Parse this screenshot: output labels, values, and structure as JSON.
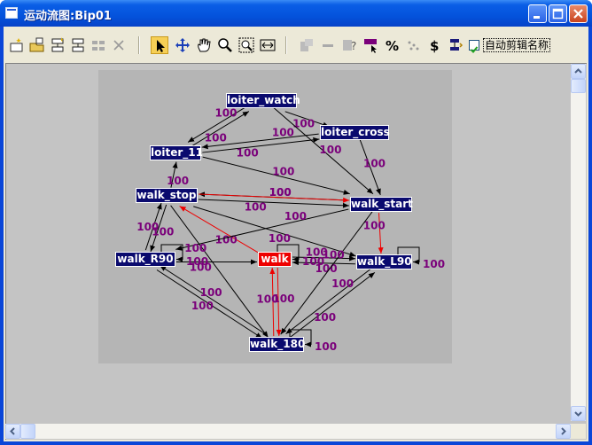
{
  "window": {
    "title": "运动流图:Bip01"
  },
  "toolbar": {
    "buttons": [
      "new-clip-icon",
      "open-clip-icon",
      "insert-transition-icon",
      "delete-transition-icon",
      "optimize-icon",
      "delete-icon",
      "select-icon",
      "move-icon",
      "pan-icon",
      "zoom-icon",
      "zoom-region-icon",
      "fit-width-icon",
      "script-icon",
      "line-icon",
      "help-icon",
      "flag-icon",
      "percent-icon",
      "random-icon",
      "dollar-icon",
      "marker-icon"
    ],
    "auto_clip_names_checked": true,
    "auto_clip_names_label": "自动剪辑名称"
  },
  "graph": {
    "nodes": [
      {
        "id": "loiter_watch",
        "label": "loiter_watch",
        "active": false
      },
      {
        "id": "loiter_cross",
        "label": "loiter_cross",
        "active": false
      },
      {
        "id": "loiter_11",
        "label": "loiter_11",
        "active": false
      },
      {
        "id": "walk_stop",
        "label": "walk_stop",
        "active": false
      },
      {
        "id": "walk_start",
        "label": "walk_start",
        "active": false
      },
      {
        "id": "walk_R90",
        "label": "walk_R90",
        "active": false
      },
      {
        "id": "walk",
        "label": "walk",
        "active": true
      },
      {
        "id": "walk_L90",
        "label": "walk_L90",
        "active": false
      },
      {
        "id": "walk_180",
        "label": "walk_180",
        "active": false
      }
    ],
    "edge_color": "#000000",
    "active_edge_color": "#ee0000",
    "label_color": "#7a007a",
    "edges": [
      {
        "from": "loiter_watch",
        "to": "loiter_11",
        "label": "100",
        "highlighted": false
      },
      {
        "from": "loiter_11",
        "to": "loiter_watch",
        "label": "100",
        "highlighted": false
      },
      {
        "from": "loiter_watch",
        "to": "loiter_cross",
        "label": "100",
        "highlighted": false
      },
      {
        "from": "loiter_watch",
        "to": "walk_start",
        "label": "100",
        "highlighted": false
      },
      {
        "from": "loiter_cross",
        "to": "loiter_11",
        "label": "100",
        "highlighted": false
      },
      {
        "from": "loiter_11",
        "to": "loiter_cross",
        "label": "100",
        "highlighted": false
      },
      {
        "from": "loiter_cross",
        "to": "walk_start",
        "label": "100",
        "highlighted": false
      },
      {
        "from": "loiter_11",
        "to": "walk_start",
        "label": "100",
        "highlighted": false
      },
      {
        "from": "walk_stop",
        "to": "loiter_11",
        "label": "100",
        "highlighted": false
      },
      {
        "from": "walk_stop",
        "to": "walk_start",
        "label": "100",
        "highlighted": false
      },
      {
        "from": "walk_start",
        "to": "walk_stop",
        "label": "100",
        "highlighted": false
      },
      {
        "from": "walk_stop",
        "to": "walk_start",
        "label": "100",
        "highlighted": true
      },
      {
        "from": "walk_start",
        "to": "walk_L90",
        "label": "100",
        "highlighted": true
      },
      {
        "from": "walk",
        "to": "walk_stop",
        "label": "100",
        "highlighted": true
      },
      {
        "from": "walk_R90",
        "to": "walk_stop",
        "label": "100",
        "highlighted": false
      },
      {
        "from": "walk_stop",
        "to": "walk_R90",
        "label": "100",
        "highlighted": false
      },
      {
        "from": "walk_R90",
        "to": "walk",
        "label": "100",
        "highlighted": false
      },
      {
        "from": "walk",
        "to": "walk_L90",
        "label": "100",
        "highlighted": false
      },
      {
        "from": "walk_L90",
        "to": "walk",
        "label": "100",
        "highlighted": false
      },
      {
        "from": "walk_stop",
        "to": "walk_L90",
        "label": "100",
        "highlighted": false
      },
      {
        "from": "walk_start",
        "to": "walk_R90",
        "label": "100",
        "highlighted": false
      },
      {
        "from": "walk_start",
        "to": "walk_180",
        "label": "100",
        "highlighted": false
      },
      {
        "from": "walk_R90",
        "to": "walk_180",
        "label": "100",
        "highlighted": false
      },
      {
        "from": "walk_180",
        "to": "walk_R90",
        "label": "100",
        "highlighted": false
      },
      {
        "from": "walk_L90",
        "to": "walk_180",
        "label": "100",
        "highlighted": false
      },
      {
        "from": "walk_180",
        "to": "walk_L90",
        "label": "100",
        "highlighted": false
      },
      {
        "from": "walk",
        "to": "walk_180",
        "label": "100",
        "highlighted": true
      },
      {
        "from": "walk_180",
        "to": "walk",
        "label": "100",
        "highlighted": true
      },
      {
        "from": "walk_stop",
        "to": "walk_180",
        "label": "100",
        "highlighted": false
      }
    ],
    "self_loops": [
      {
        "node": "walk_R90",
        "label": "100"
      },
      {
        "node": "walk",
        "label": "100"
      },
      {
        "node": "walk_L90",
        "label": "100"
      },
      {
        "node": "walk_180",
        "label": "100"
      }
    ]
  }
}
